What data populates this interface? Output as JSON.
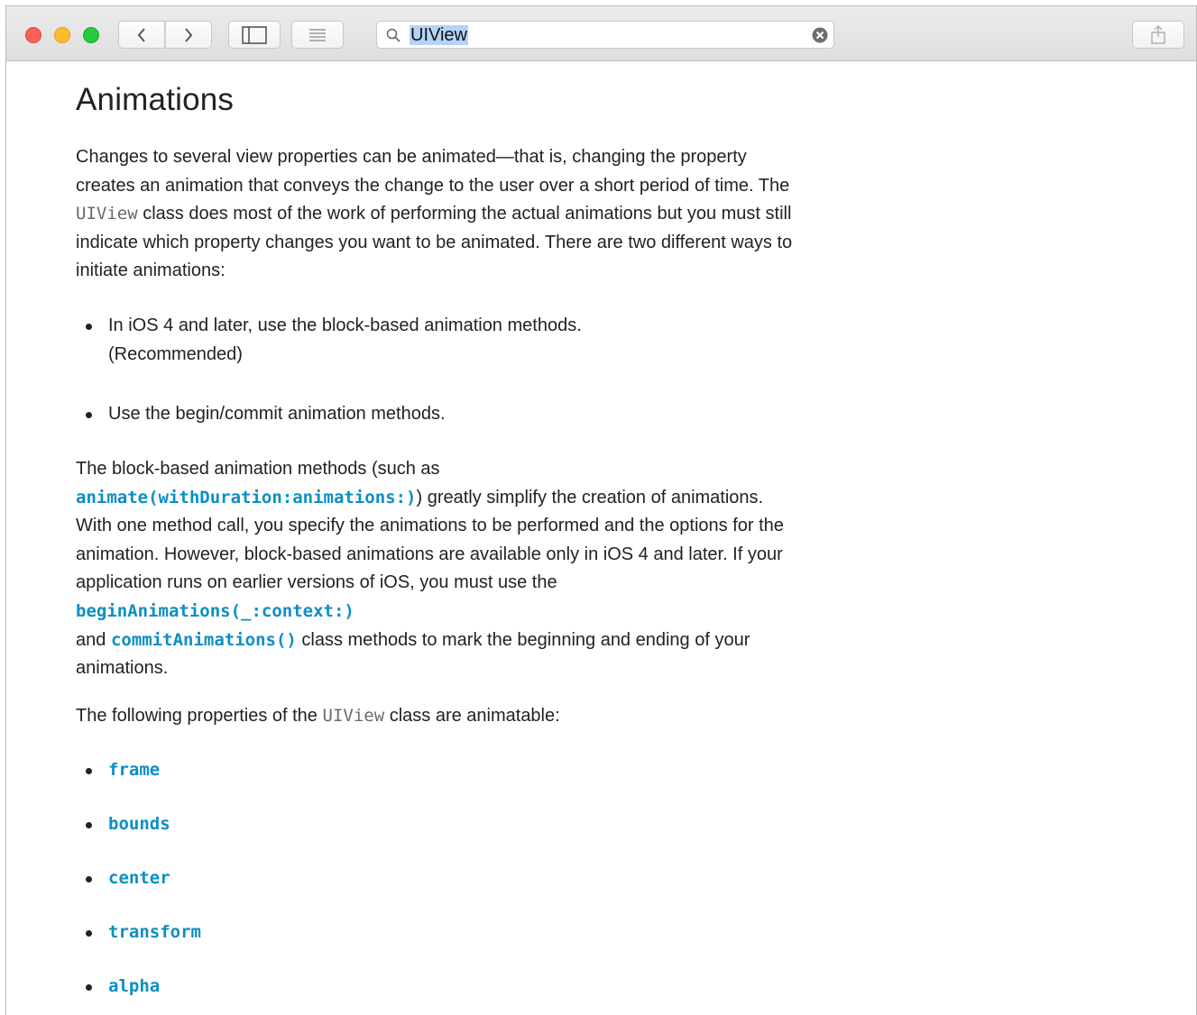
{
  "toolbar": {
    "search_value": "UIView"
  },
  "content": {
    "title": "Animations",
    "para1": "Changes to several view properties can be animated—that is, changing the property creates an animation that conveys the change to the user over a short period of time. The ",
    "para1_code": "UIView",
    "para1_end": " class does most of the work of performing the actual animations but you must still indicate which property changes you want to be animated. There are two different ways to initiate animations:",
    "bullets": [
      {
        "line1": "In iOS 4 and later, use the block-based animation methods.",
        "line2": "(Recommended)"
      },
      {
        "line1": "Use the begin/commit animation methods."
      }
    ],
    "para2_a": "The block-based animation methods (such as",
    "para2_link1": "animate(withDuration:animations:)",
    "para2_b": ") greatly simplify the creation of animations. With one method call, you specify the animations to be performed and the options for the animation. However, block-based animations are available only in iOS 4 and later. If your application runs on earlier versions of iOS, you must use the ",
    "para2_link2": "beginAnimations(_:context:)",
    "para2_c": "and ",
    "para2_link3": "commitAnimations()",
    "para2_d": " class methods to mark the beginning and ending of your animations.",
    "para3_a": "The following properties of the ",
    "para3_code": "UIView",
    "para3_b": " class are animatable:",
    "properties": [
      "frame",
      "bounds",
      "center",
      "transform",
      "alpha"
    ]
  }
}
